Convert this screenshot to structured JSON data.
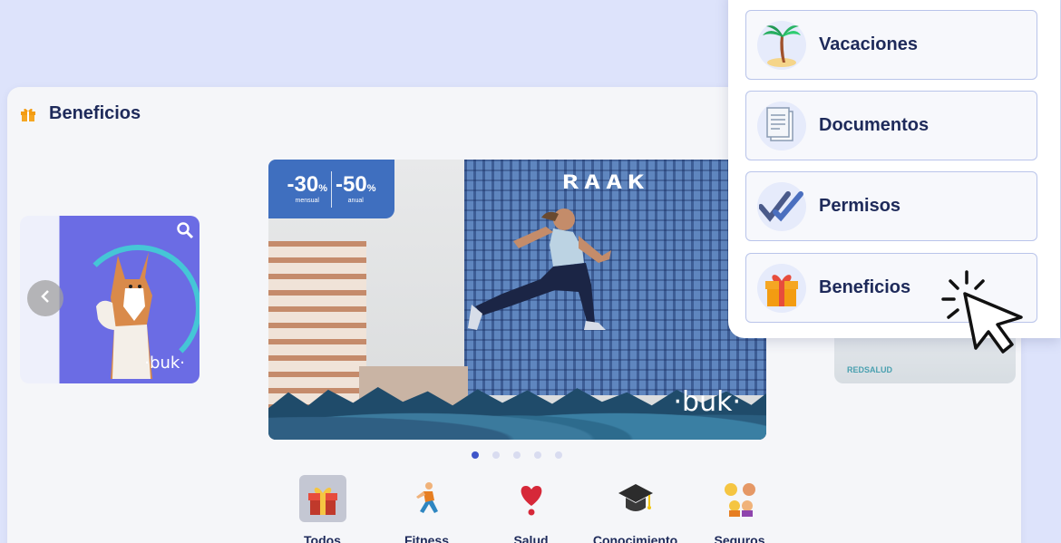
{
  "panel": {
    "title": "Beneficios",
    "icon": "gift-icon"
  },
  "carousel": {
    "left_card": {
      "brand": "·buk·"
    },
    "right_card": {
      "brand": "REDSALUD"
    },
    "banner": {
      "promo": [
        {
          "value": "-30",
          "symbol": "%",
          "caption": "mensual"
        },
        {
          "value": "-50",
          "symbol": "%",
          "caption": "anual"
        }
      ],
      "logo": "RAAK",
      "brand": "·buk·"
    },
    "dots": 5,
    "active_dot": 0
  },
  "categories": [
    {
      "label": "Todos",
      "icon": "gift-icon",
      "active": true
    },
    {
      "label": "Fitness",
      "icon": "runner-icon",
      "active": false
    },
    {
      "label": "Salud",
      "icon": "heart-icon",
      "active": false
    },
    {
      "label": "Conocimiento",
      "icon": "graduation-cap-icon",
      "active": false
    },
    {
      "label": "Seguros",
      "icon": "family-icon",
      "active": false
    }
  ],
  "menu": {
    "items": [
      {
        "label": "Vacaciones",
        "icon": "palm-tree-icon"
      },
      {
        "label": "Documentos",
        "icon": "document-icon"
      },
      {
        "label": "Permisos",
        "icon": "double-check-icon"
      },
      {
        "label": "Beneficios",
        "icon": "gift-icon"
      }
    ]
  },
  "colors": {
    "background": "#dde3fb",
    "primary_text": "#1e2a5a",
    "promo": "#3f6fbf",
    "active_dot": "#3f56c9",
    "menu_border": "#b9c4ea"
  }
}
